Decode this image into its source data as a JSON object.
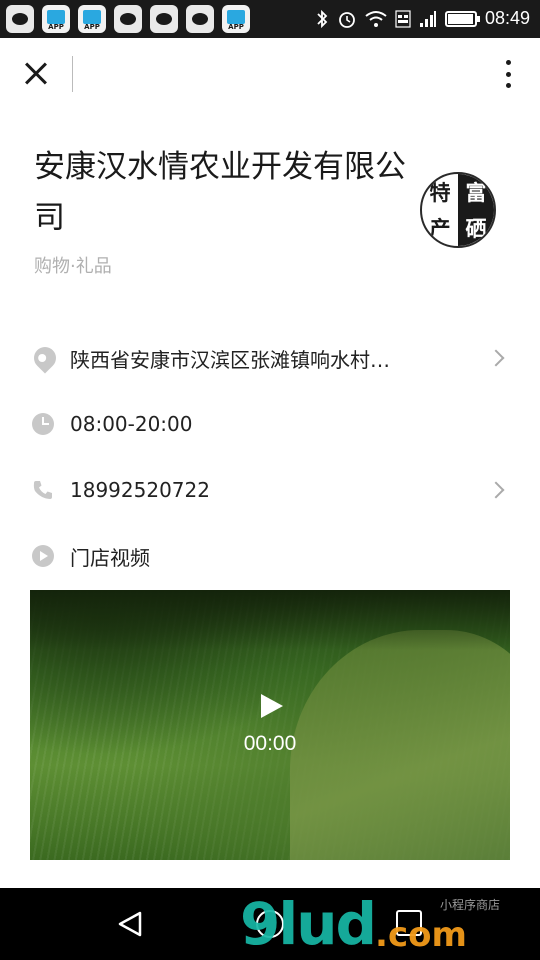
{
  "status_bar": {
    "time": "08:49",
    "app_badge": "APP",
    "notification_icons": [
      "chat-icon",
      "app-store-icon",
      "app-store-icon",
      "chat-icon",
      "chat-icon",
      "chat-icon",
      "app-store-icon"
    ],
    "system_icons": [
      "bluetooth-icon",
      "alarm-icon",
      "wifi-icon",
      "signal-4g-icon",
      "signal-icon",
      "battery-icon"
    ]
  },
  "top_bar": {
    "close_icon": "close-icon",
    "more_icon": "more-vertical-icon"
  },
  "store": {
    "name": "安康汉水情农业开发有限公司",
    "category": "购物·礼品",
    "logo_chars": [
      "特",
      "富",
      "产",
      "硒"
    ]
  },
  "info_rows": [
    {
      "icon": "location-pin-icon",
      "text": "陕西省安康市汉滨区张滩镇响水村…",
      "has_chevron": true
    },
    {
      "icon": "clock-icon",
      "text": "08:00-20:00",
      "has_chevron": false
    },
    {
      "icon": "phone-icon",
      "text": "18992520722",
      "has_chevron": true
    },
    {
      "icon": "video-play-icon",
      "text": "门店视频",
      "has_chevron": false
    }
  ],
  "video": {
    "time": "00:00"
  },
  "nav_bar": {
    "icons": [
      "back-icon",
      "home-icon",
      "recent-apps-icon"
    ]
  },
  "watermark": {
    "main": "9lud",
    "suffix": ".com",
    "sub": "小程序商店"
  },
  "colors": {
    "status_bar": "#1a1a1a",
    "muted_text": "#b0b0b0",
    "icon_gray": "#c8c8c8",
    "watermark_teal": "#17b8a6",
    "watermark_orange": "#f29a1a"
  }
}
